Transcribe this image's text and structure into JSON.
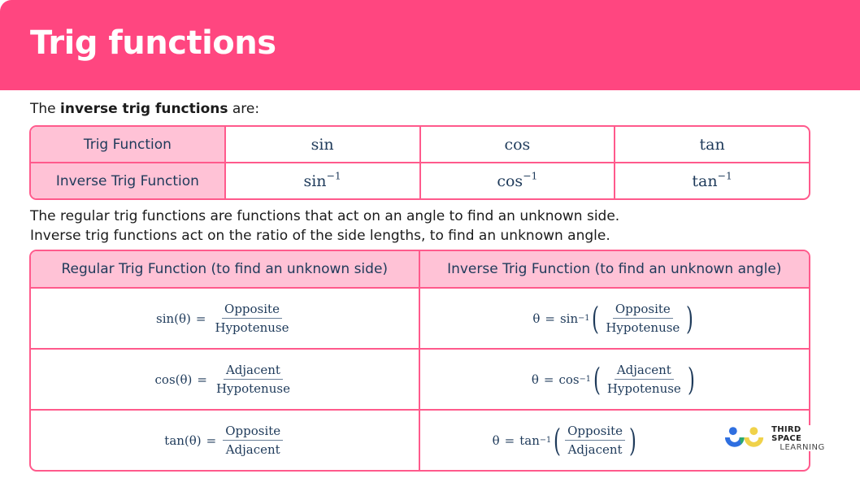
{
  "header": {
    "title": "Trig functions",
    "color": "#ff4680"
  },
  "intro": {
    "prefix": "The ",
    "bold": "inverse trig functions",
    "suffix": " are:"
  },
  "table1": {
    "row1_label": "Trig Function",
    "row2_label": "Inverse Trig Function",
    "functions": [
      {
        "name": "sin",
        "inverse": "sin",
        "exp": "−1"
      },
      {
        "name": "cos",
        "inverse": "cos",
        "exp": "−1"
      },
      {
        "name": "tan",
        "inverse": "tan",
        "exp": "−1"
      }
    ]
  },
  "paragraph": {
    "line1": "The regular trig functions are functions that act on an angle to find an unknown side.",
    "line2": "Inverse trig functions act on the ratio of the side lengths, to find an unknown angle."
  },
  "table2": {
    "headers": [
      "Regular Trig Function (to find an unknown side)",
      "Inverse Trig Function (to find an unknown angle)"
    ],
    "rows": [
      {
        "fn": "sin",
        "lhs": "sin(θ)",
        "num": "Opposite",
        "den": "Hypotenuse",
        "theta": "θ",
        "eq": "=",
        "exp": "−1"
      },
      {
        "fn": "cos",
        "lhs": "cos(θ)",
        "num": "Adjacent",
        "den": "Hypotenuse",
        "theta": "θ",
        "eq": "=",
        "exp": "−1"
      },
      {
        "fn": "tan",
        "lhs": "tan(θ)",
        "num": "Opposite",
        "den": "Adjacent",
        "theta": "θ",
        "eq": "=",
        "exp": "−1"
      }
    ]
  },
  "logo": {
    "line1": "THIRD SPACE",
    "line2": "LEARNING"
  },
  "colors": {
    "accent": "#ff4680",
    "border": "#ff5a8c",
    "header_cell": "#ffc2d6",
    "math": "#1e3a5a"
  }
}
